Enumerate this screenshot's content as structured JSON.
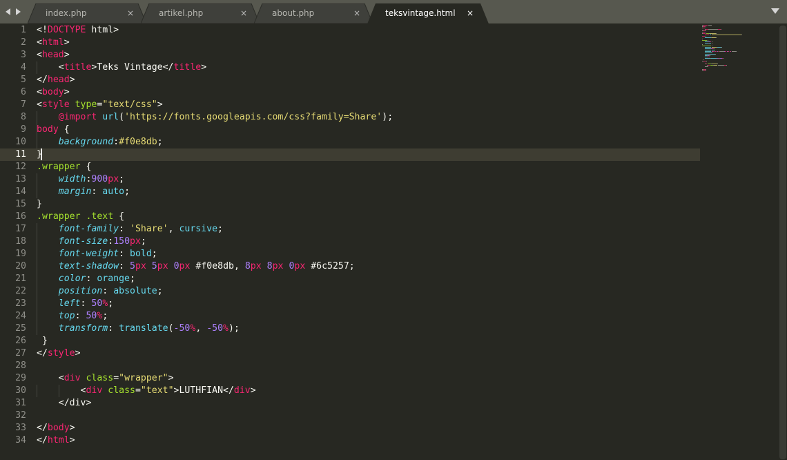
{
  "tabs": [
    {
      "label": "index.php",
      "active": false
    },
    {
      "label": "artikel.php",
      "active": false
    },
    {
      "label": "about.php",
      "active": false
    },
    {
      "label": "teksvintage.html",
      "active": true
    }
  ],
  "tab_close_glyph": "×",
  "icons": {
    "back": "triangle-left-icon",
    "forward": "triangle-right-icon",
    "tab_list": "chevron-down-icon",
    "close": "close-icon"
  },
  "colors": {
    "editor_bg": "#272822",
    "tabbar_bg": "#57584f",
    "tag": "#f92672",
    "attribute": "#a6e22e",
    "string": "#e6db74",
    "property": "#66d9ef",
    "number": "#ae81ff"
  },
  "editor": {
    "current_line": 11,
    "lines": [
      [
        {
          "t": "<!"
        },
        {
          "t": "DOCTYPE",
          "c": "tg"
        },
        {
          "t": " html>"
        }
      ],
      [
        {
          "t": "<"
        },
        {
          "t": "html",
          "c": "tg"
        },
        {
          "t": ">"
        }
      ],
      [
        {
          "t": "<"
        },
        {
          "t": "head",
          "c": "tg"
        },
        {
          "t": ">"
        }
      ],
      [
        {
          "t": "    <"
        },
        {
          "t": "title",
          "c": "tg"
        },
        {
          "t": ">Teks Vintage</"
        },
        {
          "t": "title",
          "c": "tg"
        },
        {
          "t": ">"
        }
      ],
      [
        {
          "t": "</"
        },
        {
          "t": "head",
          "c": "tg"
        },
        {
          "t": ">"
        }
      ],
      [
        {
          "t": "<"
        },
        {
          "t": "body",
          "c": "tg"
        },
        {
          "t": ">"
        }
      ],
      [
        {
          "t": "<"
        },
        {
          "t": "style",
          "c": "tg"
        },
        {
          "t": " "
        },
        {
          "t": "type",
          "c": "at"
        },
        {
          "t": "="
        },
        {
          "t": "\"text/css\"",
          "c": "st"
        },
        {
          "t": ">"
        }
      ],
      [
        {
          "t": "    "
        },
        {
          "t": "@import",
          "c": "kw"
        },
        {
          "t": " "
        },
        {
          "t": "url",
          "c": "fn"
        },
        {
          "t": "("
        },
        {
          "t": "'https://fonts.googleapis.com/css?family=Share'",
          "c": "st"
        },
        {
          "t": ");"
        }
      ],
      [
        {
          "t": "body",
          "c": "tg"
        },
        {
          "t": " {"
        }
      ],
      [
        {
          "t": "    "
        },
        {
          "t": "background",
          "c": "pr"
        },
        {
          "t": ":"
        },
        {
          "t": "#f0e8db",
          "c": "st"
        },
        {
          "t": ";"
        }
      ],
      [
        {
          "t": "}"
        }
      ],
      [
        {
          "t": ".wrapper",
          "c": "cl"
        },
        {
          "t": " {"
        }
      ],
      [
        {
          "t": "    "
        },
        {
          "t": "width",
          "c": "pr"
        },
        {
          "t": ":"
        },
        {
          "t": "900",
          "c": "nm"
        },
        {
          "t": "px",
          "c": "un"
        },
        {
          "t": ";"
        }
      ],
      [
        {
          "t": "    "
        },
        {
          "t": "margin",
          "c": "pr"
        },
        {
          "t": ": "
        },
        {
          "t": "auto",
          "c": "vl"
        },
        {
          "t": ";"
        }
      ],
      [
        {
          "t": "}"
        }
      ],
      [
        {
          "t": ".wrapper .text",
          "c": "cl"
        },
        {
          "t": " {"
        }
      ],
      [
        {
          "t": "    "
        },
        {
          "t": "font-family",
          "c": "pr"
        },
        {
          "t": ": "
        },
        {
          "t": "'Share'",
          "c": "st"
        },
        {
          "t": ", "
        },
        {
          "t": "cursive",
          "c": "vl"
        },
        {
          "t": ";"
        }
      ],
      [
        {
          "t": "    "
        },
        {
          "t": "font-size",
          "c": "pr"
        },
        {
          "t": ":"
        },
        {
          "t": "150",
          "c": "nm"
        },
        {
          "t": "px",
          "c": "un"
        },
        {
          "t": ";"
        }
      ],
      [
        {
          "t": "    "
        },
        {
          "t": "font-weight",
          "c": "pr"
        },
        {
          "t": ": "
        },
        {
          "t": "bold",
          "c": "vl"
        },
        {
          "t": ";"
        }
      ],
      [
        {
          "t": "    "
        },
        {
          "t": "text-shadow",
          "c": "pr"
        },
        {
          "t": ": "
        },
        {
          "t": "5",
          "c": "nm"
        },
        {
          "t": "px",
          "c": "un"
        },
        {
          "t": " "
        },
        {
          "t": "5",
          "c": "nm"
        },
        {
          "t": "px",
          "c": "un"
        },
        {
          "t": " "
        },
        {
          "t": "0",
          "c": "nm"
        },
        {
          "t": "px",
          "c": "un"
        },
        {
          "t": " #f0e8db, "
        },
        {
          "t": "8",
          "c": "nm"
        },
        {
          "t": "px",
          "c": "un"
        },
        {
          "t": " "
        },
        {
          "t": "8",
          "c": "nm"
        },
        {
          "t": "px",
          "c": "un"
        },
        {
          "t": " "
        },
        {
          "t": "0",
          "c": "nm"
        },
        {
          "t": "px",
          "c": "un"
        },
        {
          "t": " #6c5257;"
        }
      ],
      [
        {
          "t": "    "
        },
        {
          "t": "color",
          "c": "pr"
        },
        {
          "t": ": "
        },
        {
          "t": "orange",
          "c": "vl"
        },
        {
          "t": ";"
        }
      ],
      [
        {
          "t": "    "
        },
        {
          "t": "position",
          "c": "pr"
        },
        {
          "t": ": "
        },
        {
          "t": "absolute",
          "c": "vl"
        },
        {
          "t": ";"
        }
      ],
      [
        {
          "t": "    "
        },
        {
          "t": "left",
          "c": "pr"
        },
        {
          "t": ": "
        },
        {
          "t": "50",
          "c": "nm"
        },
        {
          "t": "%",
          "c": "un"
        },
        {
          "t": ";"
        }
      ],
      [
        {
          "t": "    "
        },
        {
          "t": "top",
          "c": "pr"
        },
        {
          "t": ": "
        },
        {
          "t": "50",
          "c": "nm"
        },
        {
          "t": "%",
          "c": "un"
        },
        {
          "t": ";"
        }
      ],
      [
        {
          "t": "    "
        },
        {
          "t": "transform",
          "c": "pr"
        },
        {
          "t": ": "
        },
        {
          "t": "translate",
          "c": "fn"
        },
        {
          "t": "("
        },
        {
          "t": "-50",
          "c": "nm"
        },
        {
          "t": "%",
          "c": "un"
        },
        {
          "t": ", "
        },
        {
          "t": "-50",
          "c": "nm"
        },
        {
          "t": "%",
          "c": "un"
        },
        {
          "t": ");"
        }
      ],
      [
        {
          "t": " }"
        }
      ],
      [
        {
          "t": "</"
        },
        {
          "t": "style",
          "c": "tg"
        },
        {
          "t": ">"
        }
      ],
      [],
      [
        {
          "t": "    <"
        },
        {
          "t": "div",
          "c": "tg"
        },
        {
          "t": " "
        },
        {
          "t": "class",
          "c": "at"
        },
        {
          "t": "="
        },
        {
          "t": "\"wrapper\"",
          "c": "st"
        },
        {
          "t": ">"
        }
      ],
      [
        {
          "t": "        <"
        },
        {
          "t": "div",
          "c": "tg"
        },
        {
          "t": " "
        },
        {
          "t": "class",
          "c": "at"
        },
        {
          "t": "="
        },
        {
          "t": "\"text\"",
          "c": "st"
        },
        {
          "t": ">LUTHFIAN</"
        },
        {
          "t": "div",
          "c": "tg"
        },
        {
          "t": ">"
        }
      ],
      [
        {
          "t": "    </div>"
        }
      ],
      [],
      [
        {
          "t": "</"
        },
        {
          "t": "body",
          "c": "tg"
        },
        {
          "t": ">"
        }
      ],
      [
        {
          "t": "</"
        },
        {
          "t": "html",
          "c": "tg"
        },
        {
          "t": ">"
        }
      ]
    ]
  }
}
